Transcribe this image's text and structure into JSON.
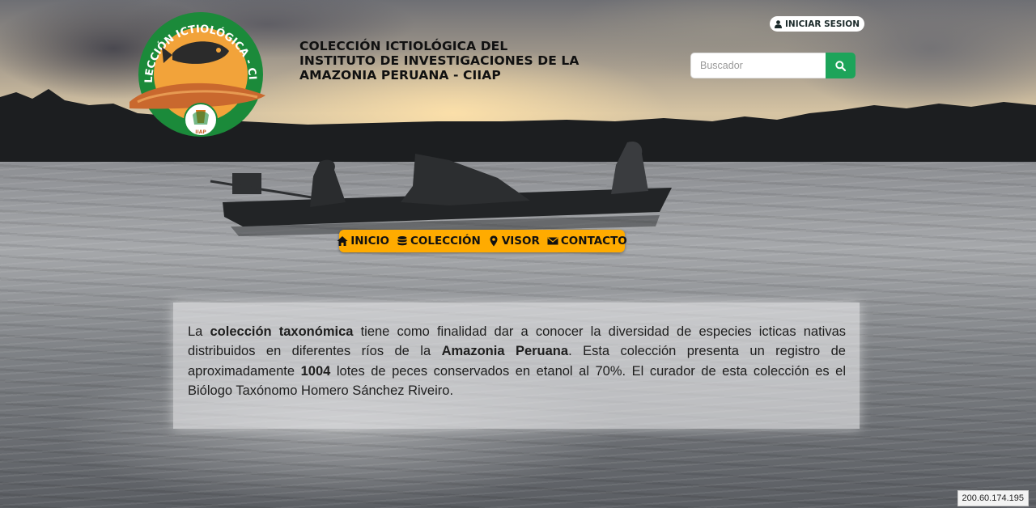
{
  "header": {
    "title_lines": [
      "COLECCIÓN ICTIOLÓGICA DEL",
      "INSTITUTO DE INVESTIGACIONES DE LA",
      "AMAZONIA PERUANA - CIIAP"
    ],
    "logo": {
      "ring_text": "COLECCIÓN ICTIOLÓGICA - CIIAP",
      "badge_text": "IIAP"
    },
    "login_label": "INICIAR SESION",
    "search": {
      "placeholder": "Buscador",
      "value": ""
    }
  },
  "nav": {
    "items": [
      {
        "label": "INICIO",
        "icon": "home-icon"
      },
      {
        "label": "COLECCIÓN",
        "icon": "database-icon"
      },
      {
        "label": "VISOR",
        "icon": "map-marker-icon"
      },
      {
        "label": "CONTACTO",
        "icon": "envelope-icon"
      }
    ]
  },
  "description": {
    "parts": [
      {
        "text": "La ",
        "bold": false
      },
      {
        "text": "colección taxonómica",
        "bold": true
      },
      {
        "text": " tiene como finalidad dar a conocer la diversidad de especies icticas nativas distribuidos en diferentes ríos de la ",
        "bold": false
      },
      {
        "text": "Amazonia Peruana",
        "bold": true
      },
      {
        "text": ". Esta colección presenta un registro de aproximadamente ",
        "bold": false
      },
      {
        "text": "1004",
        "bold": true
      },
      {
        "text": " lotes de peces conservados en etanol al 70%. El curador de esta colección es el Biólogo Taxónomo Homero Sánchez Riveiro.",
        "bold": false
      }
    ]
  },
  "footer": {
    "ip": "200.60.174.195"
  },
  "colors": {
    "accent_green": "#1da45a",
    "nav_orange": "#ffab00",
    "logo_green": "#1b8a3a",
    "logo_orange": "#f2a33a"
  }
}
